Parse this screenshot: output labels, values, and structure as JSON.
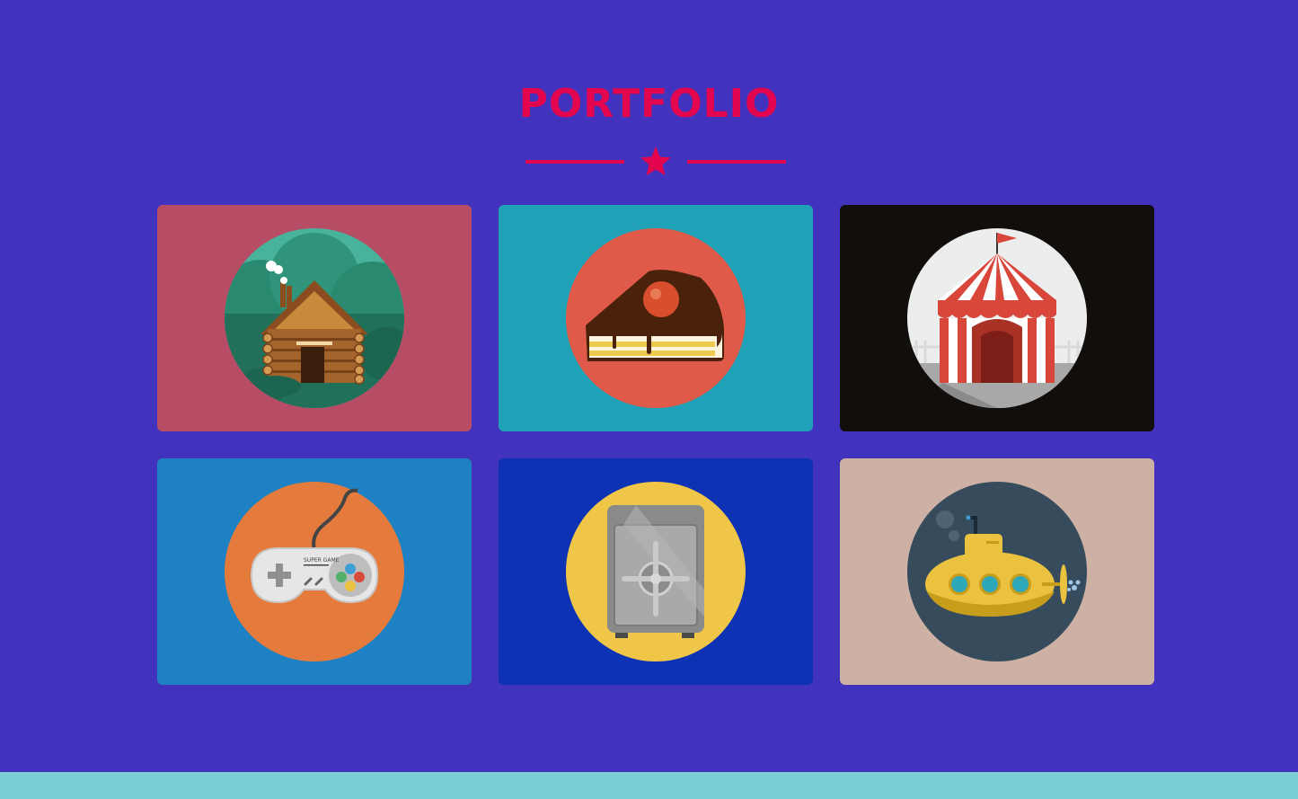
{
  "header": {
    "title": "PORTFOLIO",
    "accent_color": "#e3064f",
    "divider_icon": "star-icon"
  },
  "page": {
    "background_color": "#4133bd",
    "footer_color": "#7bced5"
  },
  "portfolio": {
    "items": [
      {
        "name": "cabin",
        "icon": "log-cabin-icon",
        "bg_color": "#b74d64",
        "circle_color": "#2f8f76"
      },
      {
        "name": "cake",
        "icon": "cake-slice-icon",
        "bg_color": "#1fa1b7",
        "circle_color": "#e05a4a"
      },
      {
        "name": "circus",
        "icon": "circus-tent-icon",
        "bg_color": "#120e0c",
        "circle_color": "#eeeeee"
      },
      {
        "name": "game",
        "icon": "game-controller-icon",
        "bg_color": "#1e81c3",
        "circle_color": "#e47b3c"
      },
      {
        "name": "safe",
        "icon": "safe-icon",
        "bg_color": "#0e32b4",
        "circle_color": "#f0c649"
      },
      {
        "name": "submarine",
        "icon": "submarine-icon",
        "bg_color": "#cdb1a4",
        "circle_color": "#364c5c"
      }
    ],
    "game_controller_text": "SUPER GAME"
  }
}
